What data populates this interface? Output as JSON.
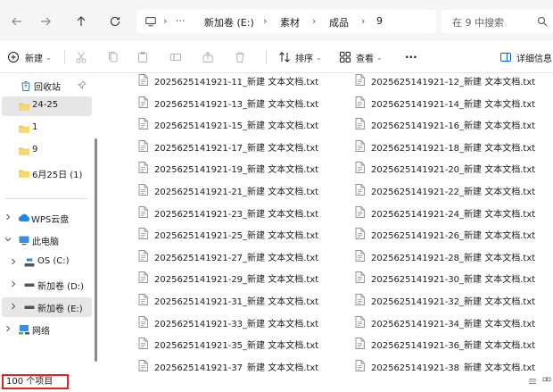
{
  "address": {
    "ellipsis": "···",
    "crumbs": [
      "新加卷 (E:)",
      "素材",
      "成品",
      "9"
    ],
    "search_placeholder": "在 9 中搜索"
  },
  "toolbar": {
    "new_label": "新建",
    "sort_label": "排序",
    "view_label": "查看",
    "more_label": "···",
    "details_label": "详细信息"
  },
  "sidebar": {
    "items": [
      {
        "label": "回收站",
        "icon": "recycle-bin-icon"
      },
      {
        "label": "24-25",
        "icon": "folder-icon"
      },
      {
        "label": "1",
        "icon": "folder-icon"
      },
      {
        "label": "9",
        "icon": "folder-icon"
      },
      {
        "label": "6月25日 (1)",
        "icon": "folder-icon"
      },
      {
        "label": "WPS云盘",
        "icon": "cloud-icon"
      },
      {
        "label": "此电脑",
        "icon": "computer-icon"
      },
      {
        "label": "OS (C:)",
        "icon": "os-drive-icon"
      },
      {
        "label": "新加卷 (D:)",
        "icon": "drive-icon"
      },
      {
        "label": "新加卷 (E:)",
        "icon": "drive-icon"
      },
      {
        "label": "网络",
        "icon": "network-icon"
      }
    ]
  },
  "files": {
    "left": [
      "2025625141921-11_新建 文本文档.txt",
      "2025625141921-13_新建 文本文档.txt",
      "2025625141921-15_新建 文本文档.txt",
      "2025625141921-17_新建 文本文档.txt",
      "2025625141921-19_新建 文本文档.txt",
      "2025625141921-21_新建 文本文档.txt",
      "2025625141921-23_新建 文本文档.txt",
      "2025625141921-25_新建 文本文档.txt",
      "2025625141921-27_新建 文本文档.txt",
      "2025625141921-29_新建 文本文档.txt",
      "2025625141921-31_新建 文本文档.txt",
      "2025625141921-33_新建 文本文档.txt",
      "2025625141921-35_新建 文本文档.txt",
      "2025625141921-37_新建 文本文档.txt"
    ],
    "right": [
      "2025625141921-12_新建 文本文档.txt",
      "2025625141921-14_新建 文本文档.txt",
      "2025625141921-16_新建 文本文档.txt",
      "2025625141921-18_新建 文本文档.txt",
      "2025625141921-20_新建 文本文档.txt",
      "2025625141921-22_新建 文本文档.txt",
      "2025625141921-24_新建 文本文档.txt",
      "2025625141921-26_新建 文本文档.txt",
      "2025625141921-28_新建 文本文档.txt",
      "2025625141921-30_新建 文本文档.txt",
      "2025625141921-32_新建 文本文档.txt",
      "2025625141921-34_新建 文本文档.txt",
      "2025625141921-36_新建 文本文档.txt",
      "2025625141921-38_新建 文本文档.txt"
    ]
  },
  "status": {
    "count_label": "100 个项目",
    "highlight_color": "#e0251f"
  },
  "colors": {
    "folder": "#f2c94c",
    "accent": "#0067c0",
    "selected_bg": "#e6e6e6"
  }
}
